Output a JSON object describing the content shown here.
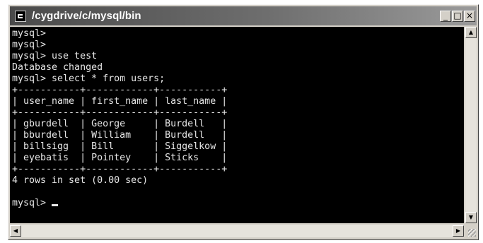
{
  "window": {
    "title": "/cygdrive/c/mysql/bin",
    "minimize_label": "_",
    "maximize_label": "□",
    "close_label": "×"
  },
  "terminal": {
    "lines": [
      "mysql>",
      "mysql>",
      "mysql> use test",
      "Database changed",
      "mysql> select * from users;",
      "+-----------+------------+-----------+",
      "| user_name | first_name | last_name |",
      "+-----------+------------+-----------+",
      "| gburdell  | George     | Burdell   |",
      "| bburdell  | William    | Burdell   |",
      "| billsigg  | Bill       | Siggelkow |",
      "| eyebatis  | Pointey    | Sticks    |",
      "+-----------+------------+-----------+",
      "4 rows in set (0.00 sec)",
      "",
      "mysql> "
    ],
    "prompt": "mysql>",
    "query": "select * from users;",
    "result_table": {
      "columns": [
        "user_name",
        "first_name",
        "last_name"
      ],
      "rows": [
        [
          "gburdell",
          "George",
          "Burdell"
        ],
        [
          "bburdell",
          "William",
          "Burdell"
        ],
        [
          "billsigg",
          "Bill",
          "Siggelkow"
        ],
        [
          "eyebatis",
          "Pointey",
          "Sticks"
        ]
      ],
      "summary": "4 rows in set (0.00 sec)"
    }
  },
  "scrollbars": {
    "up_icon": "▲",
    "down_icon": "▼",
    "left_icon": "◀",
    "right_icon": "▶"
  }
}
